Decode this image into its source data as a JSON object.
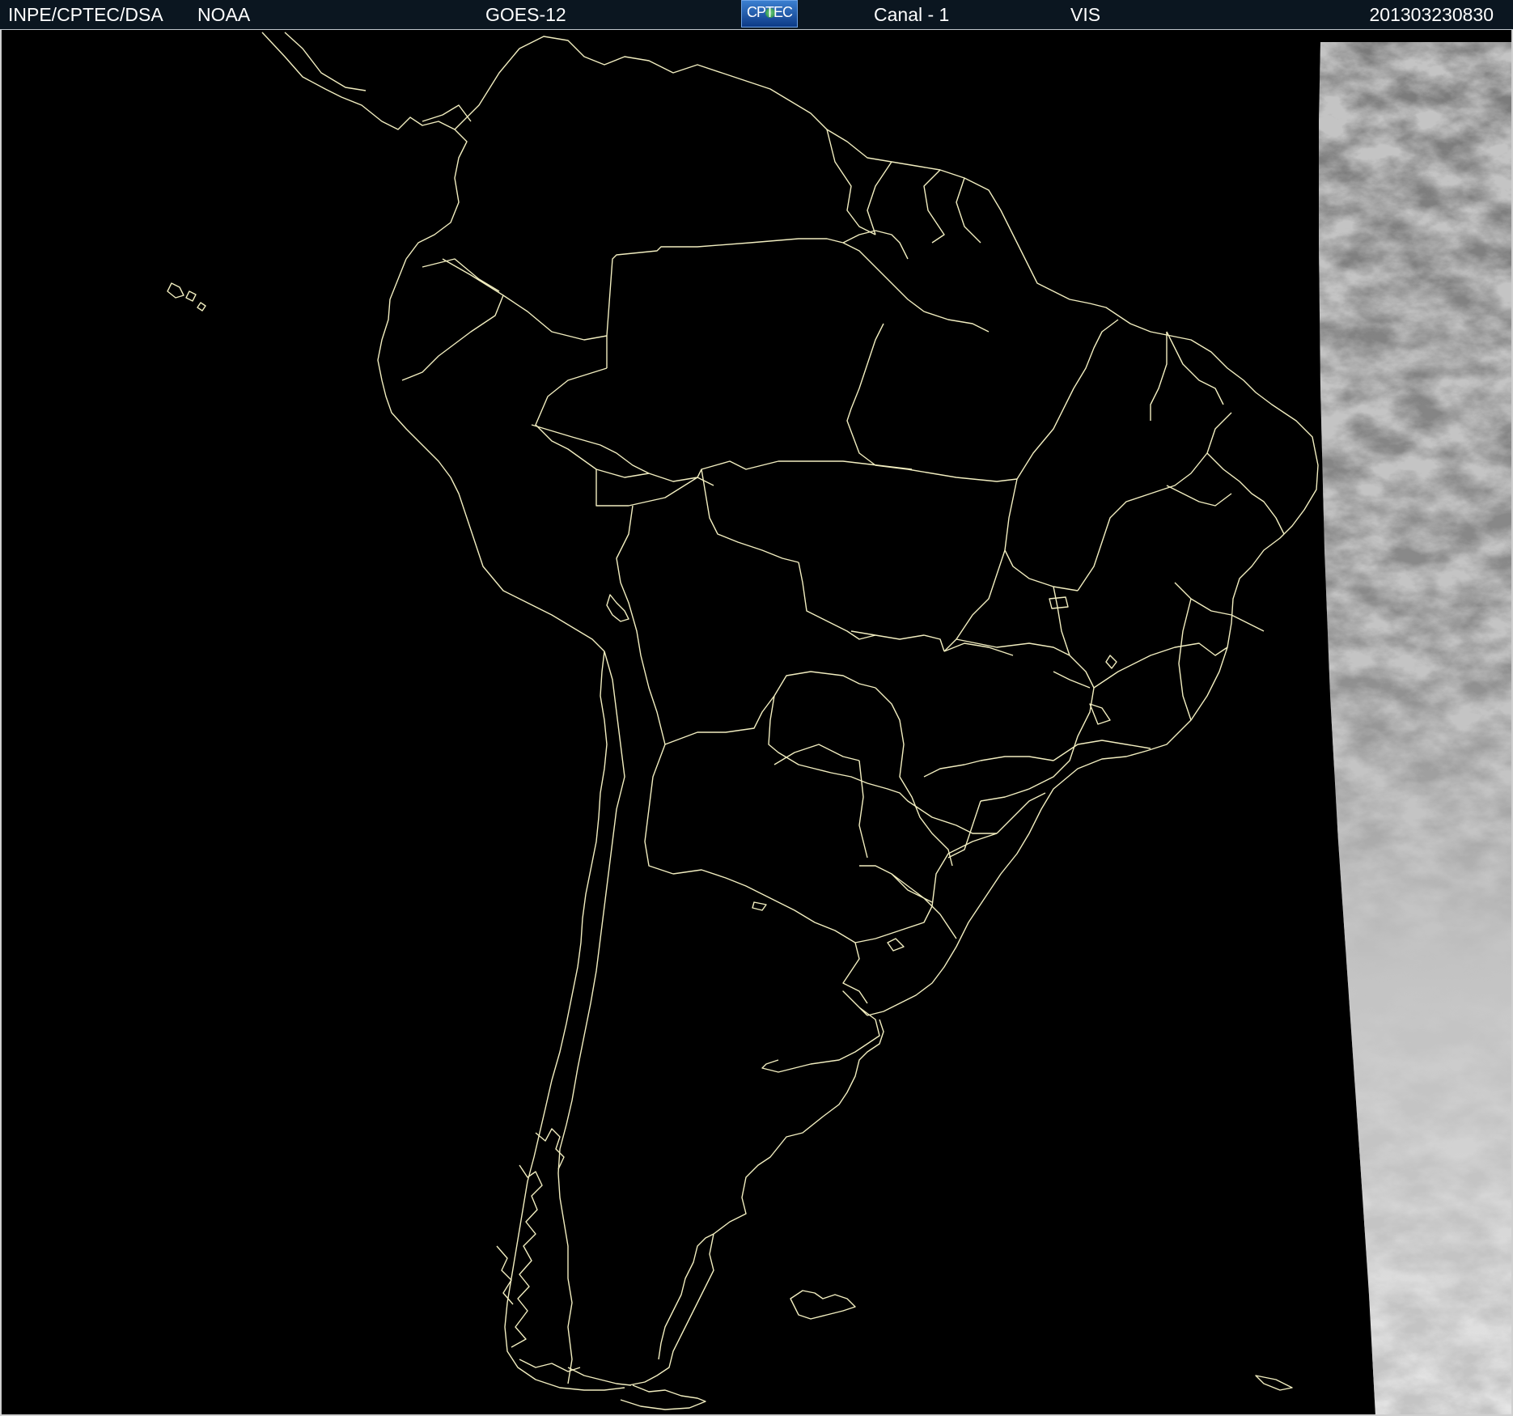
{
  "header": {
    "organization": "INPE/CPTEC/DSA",
    "agency": "NOAA",
    "satellite": "GOES-12",
    "logo_text": "CPTEC",
    "channel": "Canal - 1",
    "band": "VIS",
    "timestamp": "201303230830"
  },
  "map": {
    "region": "South America",
    "background_color": "#000000",
    "coastline_color": "#f2eec0",
    "cloud_strip_side": "right"
  }
}
